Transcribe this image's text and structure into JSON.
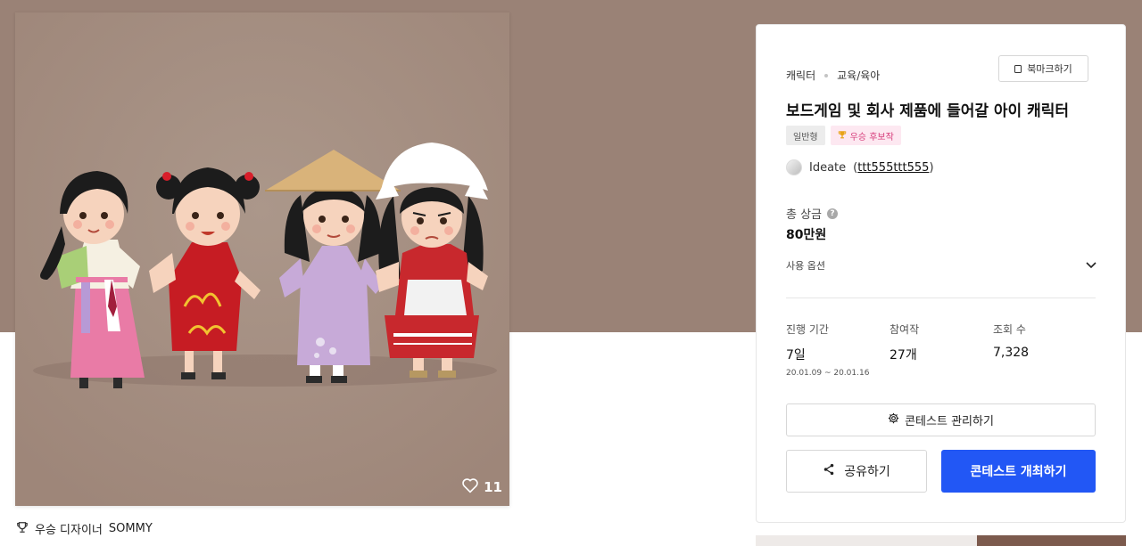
{
  "artwork": {
    "like_count": "11",
    "winner_label": "우승 디자이너",
    "winner_name": "SOMMY",
    "colors": {
      "background": "#a28d80",
      "hero": "#9a8276"
    },
    "icons": {
      "like": "heart-icon",
      "trophy": "trophy-icon"
    }
  },
  "contest": {
    "category": "캐릭터",
    "subcategory": "교육/육아",
    "bookmark_label": "북마크하기",
    "title": "보드게임 및 회사 제품에 들어갈 아이 캐릭터",
    "badges": {
      "type": "일반형",
      "candidate": "우승 후보작"
    },
    "host_name": "Ideate",
    "host_handle": "ttt555ttt555",
    "prize_label": "총 상금",
    "prize_value": "80만원",
    "usage_label": "사용 옵션",
    "stats": {
      "period_label": "진행 기간",
      "period_value": "7일",
      "period_range": "20.01.09 ~ 20.01.16",
      "entries_label": "참여작",
      "entries_value": "27개",
      "views_label": "조회 수",
      "views_value": "7,328"
    },
    "buttons": {
      "manage": "콘테스트 관리하기",
      "share": "공유하기",
      "host": "콘테스트 개최하기"
    },
    "colors": {
      "primary": "#2257f5",
      "candidate_badge": "#d63b7a"
    }
  }
}
